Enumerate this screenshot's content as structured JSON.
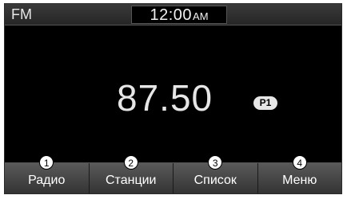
{
  "status_bar": {
    "mode": "FM",
    "time": "12:00",
    "ampm": "AM"
  },
  "radio": {
    "frequency": "87.50",
    "preset": "P1"
  },
  "softkeys": [
    {
      "number": "1",
      "label": "Радио"
    },
    {
      "number": "2",
      "label": "Станции"
    },
    {
      "number": "3",
      "label": "Список"
    },
    {
      "number": "4",
      "label": "Меню"
    }
  ]
}
